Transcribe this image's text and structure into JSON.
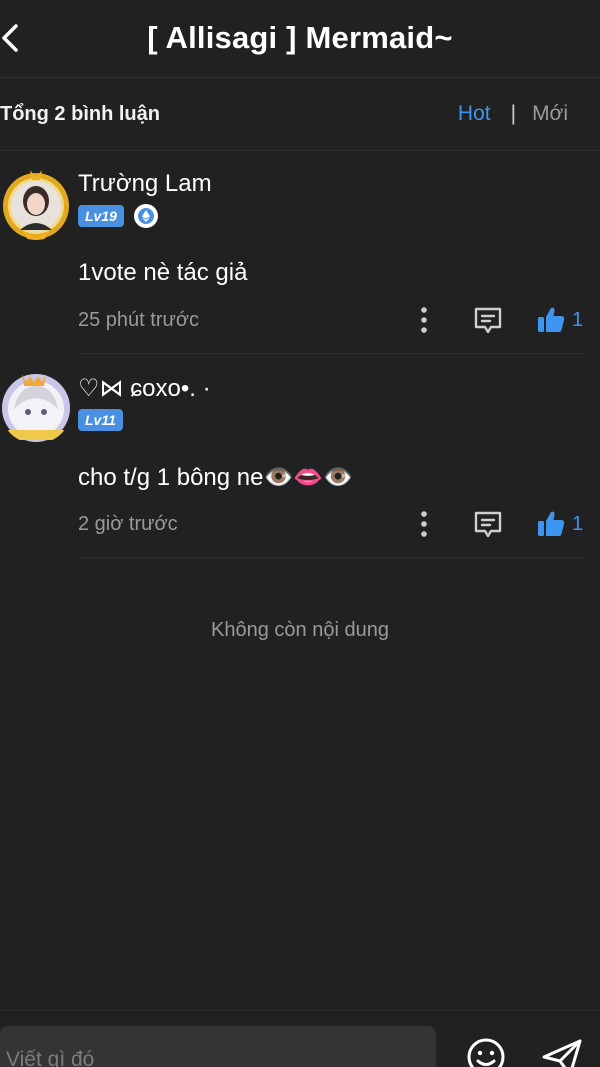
{
  "header": {
    "title": "[ Allisagi ] Mermaid~",
    "back_icon": "chevron-left-icon"
  },
  "subbar": {
    "total": "Tổng 2 bình luận",
    "sort_hot": "Hot",
    "sort_separator": "|",
    "sort_new": "Mới"
  },
  "comments": [
    {
      "username": "Trường Lam",
      "level": "Lv19",
      "text": "1vote nè tác giả",
      "time": "25 phút trước",
      "likes": "1",
      "badge_icon": "ethereum-icon"
    },
    {
      "username": "♡⋈ ɕoxo•. ·",
      "level": "Lv11",
      "text": "cho t/g 1 bông ne👁️👄👁️",
      "time": "2 giờ trước",
      "likes": "1"
    }
  ],
  "end_message": "Không còn nội dung",
  "footer": {
    "placeholder": "Viết gì đó"
  },
  "colors": {
    "background": "#212121",
    "accent": "#3d95f0",
    "level_badge": "#4a90e2",
    "muted_text": "#9a9a9a"
  }
}
